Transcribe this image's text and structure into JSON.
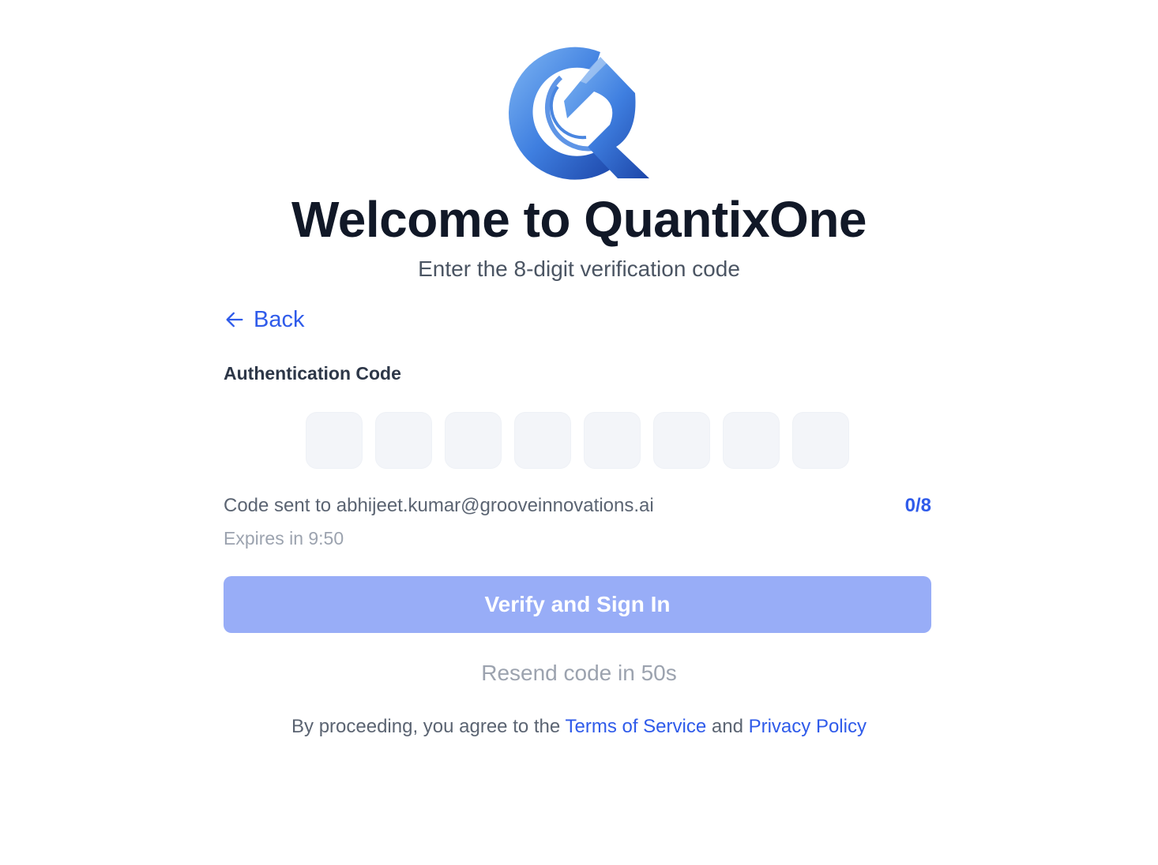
{
  "brand": {
    "logo_icon": "quantixone-q-logo-icon",
    "colors": {
      "logo_light": "#6ea8f0",
      "logo_dark": "#1f4fb8",
      "accent": "#2f5bea",
      "button_disabled": "#98adf7",
      "heading": "#111827"
    }
  },
  "header": {
    "title": "Welcome to QuantixOne",
    "subtitle": "Enter the 8-digit verification code"
  },
  "nav": {
    "back_label": "Back",
    "back_icon": "arrow-left-icon"
  },
  "form": {
    "code_label": "Authentication Code",
    "digits": [
      "",
      "",
      "",
      "",
      "",
      "",
      "",
      ""
    ],
    "sent_text": "Code sent to abhijeet.kumar@grooveinnovations.ai",
    "counter": "0/8",
    "expires_text": "Expires in 9:50",
    "submit_label": "Verify and Sign In",
    "resend_text": "Resend code in 50s"
  },
  "legal": {
    "prefix": "By proceeding, you agree to the ",
    "terms_label": "Terms of Service",
    "joiner": " and ",
    "privacy_label": "Privacy Policy"
  }
}
